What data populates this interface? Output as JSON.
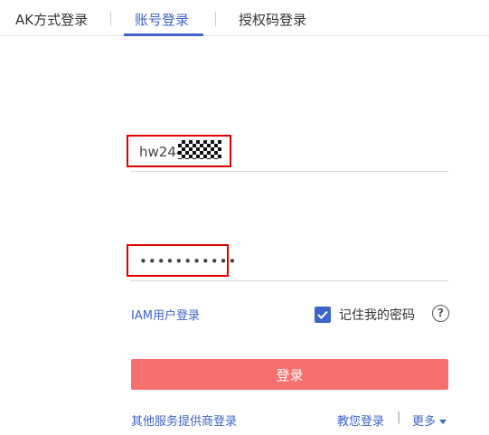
{
  "tabs": [
    {
      "label": "AK方式登录",
      "active": false
    },
    {
      "label": "账号登录",
      "active": true
    },
    {
      "label": "授权码登录",
      "active": false
    }
  ],
  "account": {
    "value": "hw244"
  },
  "password": {
    "value": "•••••••••••"
  },
  "options": {
    "iam_login_label": "IAM用户登录",
    "remember_label": "记住我的密码",
    "remember_checked": true,
    "help_label": "?"
  },
  "login_button": {
    "label": "登录"
  },
  "footer": {
    "other_provider_label": "其他服务提供商登录",
    "tutorial_label": "教您登录",
    "separator": "|",
    "more_label": "更多"
  },
  "colors": {
    "accent": "#3d64c8",
    "login_button": "#f7706e",
    "highlight": "#e00000"
  }
}
